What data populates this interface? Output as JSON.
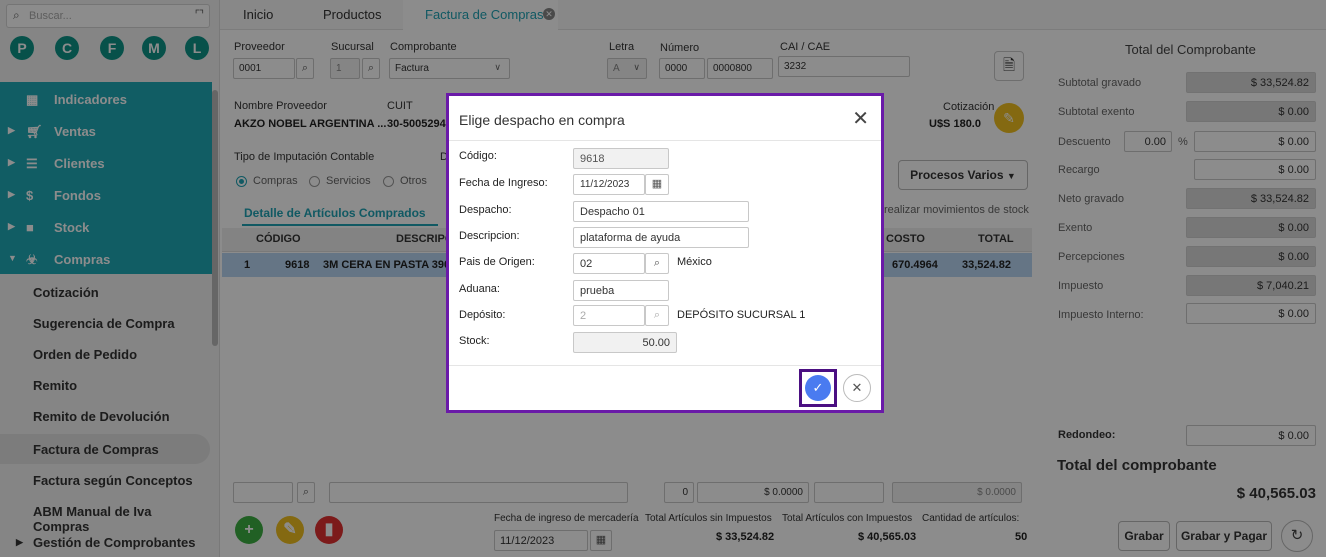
{
  "sidebar": {
    "search_placeholder": "Buscar...",
    "shortcuts": [
      "P",
      "C",
      "F",
      "M",
      "L"
    ],
    "nav": [
      "Indicadores",
      "Ventas",
      "Clientes",
      "Fondos",
      "Stock",
      "Compras"
    ],
    "sub": [
      "Cotización",
      "Sugerencia de Compra",
      "Orden de Pedido",
      "Remito",
      "Remito de Devolución",
      "Factura de Compras",
      "Factura según Conceptos",
      "ABM Manual de Iva Compras",
      "Gestión de Comprobantes"
    ]
  },
  "tabs": [
    "Inicio",
    "Productos",
    "Factura de Compras"
  ],
  "form": {
    "proveedor_lbl": "Proveedor",
    "proveedor": "0001",
    "sucursal_lbl": "Sucursal",
    "sucursal": "1",
    "comprobante_lbl": "Comprobante",
    "comprobante": "Factura",
    "letra_lbl": "Letra",
    "letra": "A",
    "numero_lbl": "Número",
    "numero_a": "0000",
    "numero_b": "0000800",
    "cai_lbl": "CAI / CAE",
    "cai": "3232",
    "nombre_lbl": "Nombre Proveedor",
    "nombre": "AKZO NOBEL ARGENTINA ...",
    "cuit_lbl": "CUIT",
    "cuit": "30-5005294",
    "cotizacion_lbl": "Cotización",
    "cotizacion": "U$S 180.0",
    "imputacion_lbl": "Tipo de Imputación Contable",
    "imputacion_d_lbl": "D",
    "radios": [
      "Compras",
      "Servicios",
      "Otros"
    ],
    "procesos": "Procesos Varios",
    "detalle": "Detalle de Artículos Comprados",
    "detalle_hint": "realizar movimientos de stock"
  },
  "table": {
    "headers": [
      "CÓDIGO",
      "DESCRIPCI",
      "COSTO",
      "TOTAL"
    ],
    "row": {
      "n": "1",
      "codigo": "9618",
      "desc": "3M CERA EN PASTA 390",
      "costo": "670.4964",
      "total": "33,524.82"
    }
  },
  "totals": {
    "title": "Total del Comprobante",
    "rows": [
      {
        "label": "Subtotal gravado",
        "value": "$ 33,524.82"
      },
      {
        "label": "Subtotal exento",
        "value": "$ 0.00"
      },
      {
        "label": "Descuento",
        "value": "$ 0.00"
      },
      {
        "label": "Recargo",
        "value": "$ 0.00"
      },
      {
        "label": "Neto gravado",
        "value": "$ 33,524.82"
      },
      {
        "label": "Exento",
        "value": "$ 0.00"
      },
      {
        "label": "Percepciones",
        "value": "$ 0.00"
      },
      {
        "label": "Impuesto",
        "value": "$ 7,040.21"
      },
      {
        "label": "Impuesto Interno:",
        "value": "$ 0.00"
      }
    ],
    "descuento_pct": "0.00",
    "pct_sign": "%",
    "redondeo_lbl": "Redondeo:",
    "redondeo": "$ 0.00",
    "total_lbl": "Total del comprobante",
    "total": "$ 40,565.03"
  },
  "bottom": {
    "qty": "0",
    "amt1": "$ 0.0000",
    "amt2": "$ 0.0000",
    "fecha_lbl": "Fecha de ingreso de mercadería",
    "fecha": "11/12/2023",
    "sin_imp_lbl": "Total Artículos sin Impuestos",
    "sin_imp": "$ 33,524.82",
    "con_imp_lbl": "Total Artículos con Impuestos",
    "con_imp": "$ 40,565.03",
    "cant_lbl": "Cantidad de artículos:",
    "cant": "50",
    "grabar": "Grabar",
    "grabar_pagar": "Grabar y Pagar"
  },
  "modal": {
    "title": "Elige despacho en compra",
    "codigo_lbl": "Código:",
    "codigo": "9618",
    "fecha_lbl": "Fecha de Ingreso:",
    "fecha": "11/12/2023",
    "despacho_lbl": "Despacho:",
    "despacho": "Despacho 01",
    "desc_lbl": "Descripcion:",
    "desc": "plataforma de ayuda",
    "pais_lbl": "Pais de Origen:",
    "pais": "02",
    "pais_name": "México",
    "aduana_lbl": "Aduana:",
    "aduana": "prueba",
    "deposito_lbl": "Depósito:",
    "deposito": "2",
    "deposito_name": "DEPÓSITO SUCURSAL 1",
    "stock_lbl": "Stock:",
    "stock": "50.00"
  }
}
